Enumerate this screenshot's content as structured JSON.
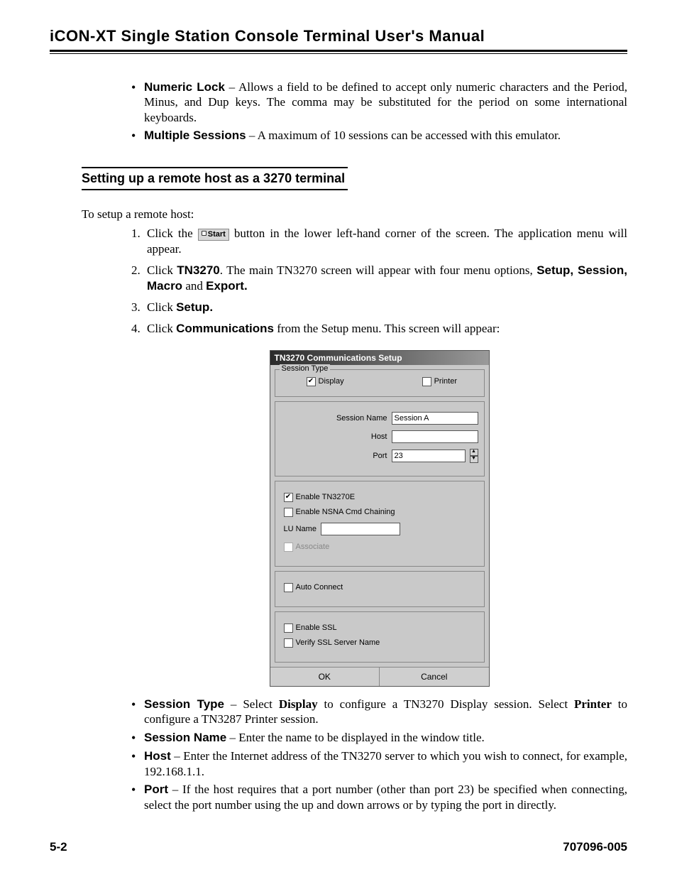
{
  "header": {
    "title": "iCON-XT Single Station Console Terminal User's Manual"
  },
  "bullets_top": {
    "b1_label": "Numeric Lock",
    "b1_text": " – Allows a field to be defined to accept only numeric characters and the Period, Minus, and Dup keys. The comma may be substituted for the period on some international keyboards.",
    "b2_label": "Multiple Sessions",
    "b2_text": " – A maximum of 10 sessions can be accessed with this emulator."
  },
  "section_heading": "Setting up a remote host as a 3270 terminal",
  "intro": "To setup a remote host:",
  "start_label": "Start",
  "steps": {
    "s1a": "Click the ",
    "s1b": " button in the lower left-hand corner of the screen. The application menu will appear.",
    "s2a": "Click ",
    "s2a_bold": "TN3270",
    "s2b": ". The main TN3270 screen will appear with four menu options, ",
    "s2b_bold": "Setup, Session, Macro",
    "s2c": " and ",
    "s2c_bold": "Export.",
    "s3a": "Click ",
    "s3_bold": "Setup.",
    "s4a": "Click ",
    "s4_bold": "Communications",
    "s4b": " from the Setup menu. This screen will appear:"
  },
  "dialog": {
    "title": "TN3270 Communications Setup",
    "session_type_legend": "Session Type",
    "display_label": "Display",
    "printer_label": "Printer",
    "session_name_label": "Session Name",
    "session_name_value": "Session A",
    "host_label": "Host",
    "host_value": "",
    "port_label": "Port",
    "port_value": "23",
    "enable_tn3270e": "Enable TN3270E",
    "enable_nsna": "Enable NSNA Cmd Chaining",
    "lu_name_label": "LU Name",
    "lu_name_value": "",
    "associate": "Associate",
    "auto_connect": "Auto Connect",
    "enable_ssl": "Enable SSL",
    "verify_ssl": "Verify SSL Server Name",
    "ok": "OK",
    "cancel": "Cancel"
  },
  "desc": {
    "d1_label": "Session Type",
    "d1_a": " – Select ",
    "d1_b1": "Display",
    "d1_c": " to configure a TN3270 Display session. Select ",
    "d1_b2": "Printer",
    "d1_d": " to configure a TN3287 Printer session.",
    "d2_label": "Session Name",
    "d2_text": " – Enter the name to be displayed in the window title.",
    "d3_label": "Host",
    "d3_text": " – Enter the Internet address of the TN3270 server to which you wish to connect, for example, 192.168.1.1.",
    "d4_label": "Port",
    "d4_text": " – If the host requires that a port number (other than port 23) be specified when connecting, select the port number using the up and down arrows or by typing the port in directly."
  },
  "footer": {
    "page": "5-2",
    "docnum": "707096-005"
  }
}
